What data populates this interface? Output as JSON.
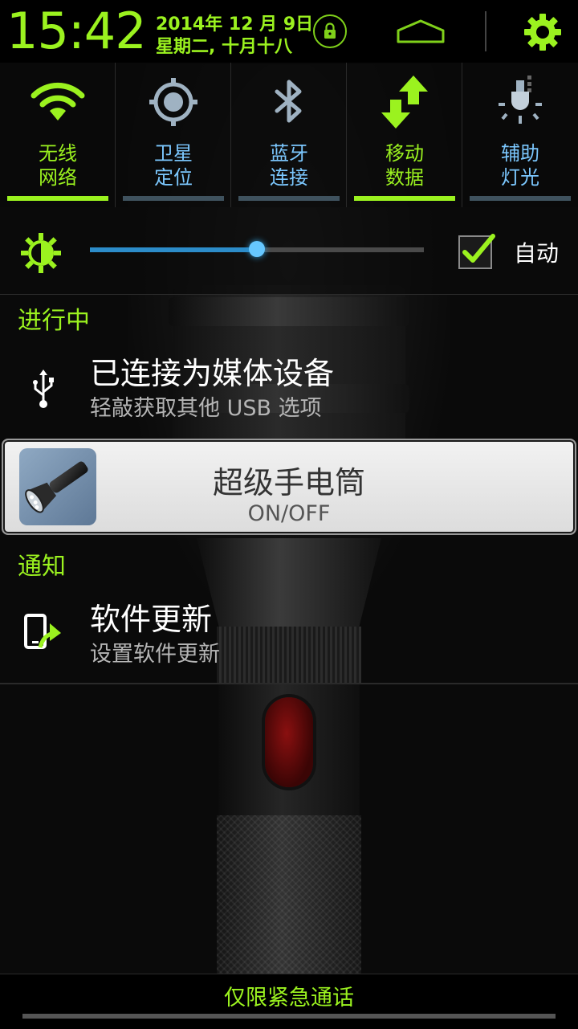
{
  "status": {
    "time": "15:42",
    "date_line1": "2014年 12 月 9日",
    "date_line2": "星期二, 十月十八",
    "accent_color": "#9bf21f"
  },
  "toggles": [
    {
      "label1": "无线",
      "label2": "网络",
      "icon": "wifi-icon",
      "on": true
    },
    {
      "label1": "卫星",
      "label2": "定位",
      "icon": "gps-icon",
      "on": false
    },
    {
      "label1": "蓝牙",
      "label2": "连接",
      "icon": "bluetooth-icon",
      "on": false
    },
    {
      "label1": "移动",
      "label2": "数据",
      "icon": "mobile-data-icon",
      "on": true
    },
    {
      "label1": "辅助",
      "label2": "灯光",
      "icon": "assist-light-icon",
      "on": false
    }
  ],
  "brightness": {
    "level": 0.5,
    "auto_label": "自动",
    "auto_checked": true
  },
  "ongoing": {
    "section_title": "进行中",
    "usb": {
      "title": "已连接为媒体设备",
      "subtitle": "轻敲获取其他 USB 选项"
    },
    "flashlight": {
      "title": "超级手电筒",
      "subtitle": "ON/OFF"
    }
  },
  "notifications": {
    "section_title": "通知",
    "update": {
      "title": "软件更新",
      "subtitle": "设置软件更新"
    }
  },
  "footer": {
    "emergency_label": "仅限紧急通话"
  }
}
